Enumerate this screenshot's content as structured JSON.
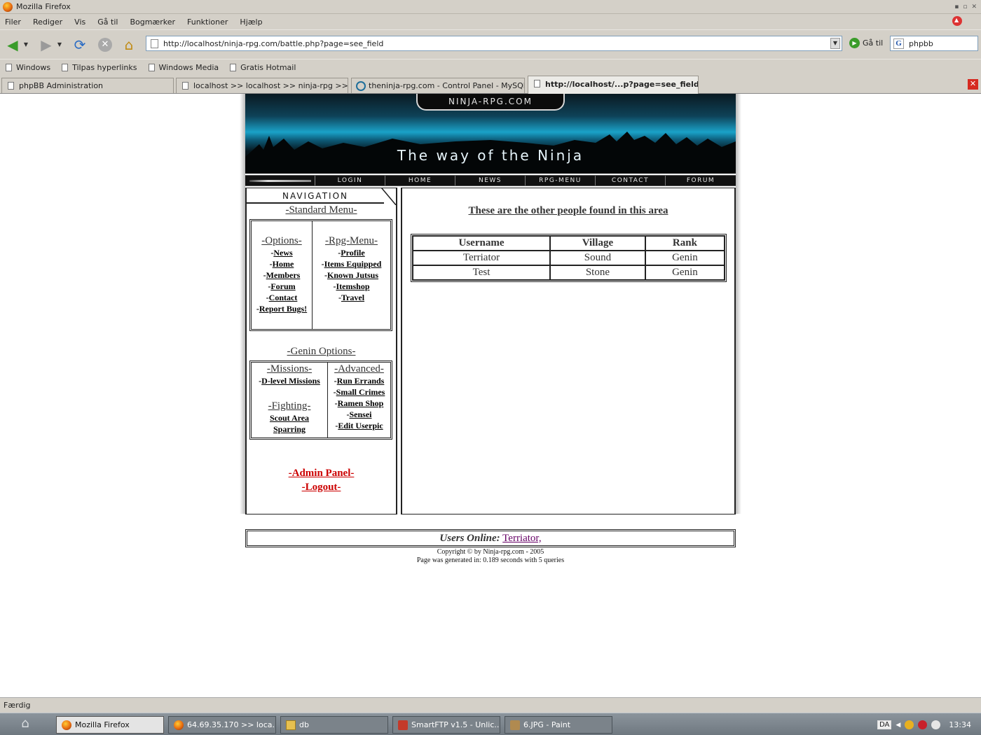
{
  "window": {
    "title": "Mozilla Firefox"
  },
  "menubar": [
    "Filer",
    "Rediger",
    "Vis",
    "Gå til",
    "Bogmærker",
    "Funktioner",
    "Hjælp"
  ],
  "toolbar": {
    "url": "http://localhost/ninja-rpg.com/battle.php?page=see_field",
    "go_label": "Gå til",
    "search_value": "phpbb",
    "icons": [
      "back-icon",
      "forward-icon",
      "reload-icon",
      "stop-icon",
      "home-icon"
    ]
  },
  "bookmarks": [
    "Windows",
    "Tilpas hyperlinks",
    "Windows Media",
    "Gratis Hotmail"
  ],
  "tabs": [
    {
      "label": "phpBB Administration"
    },
    {
      "label": "localhost >> localhost >> ninja-rpg  >> ..."
    },
    {
      "label": "theninja-rpg.com - Control Panel - MySQL ..."
    },
    {
      "label": "http://localhost/...p?page=see_field"
    }
  ],
  "site": {
    "logo_text": "NINJA-RPG.COM",
    "tagline": "The way of the Ninja",
    "topnav": [
      "Login",
      "Home",
      "News",
      "RPG-Menu",
      "Contact",
      "Forum"
    ],
    "nav_header": "NAVIGATION",
    "standard_menu_title": "-Standard Menu-",
    "options": {
      "title": "-Options-",
      "links": [
        {
          "prefix": "-",
          "label": "News"
        },
        {
          "prefix": "-",
          "label": "Home"
        },
        {
          "prefix": "-",
          "label": "Members"
        },
        {
          "prefix": "-",
          "label": "Forum"
        },
        {
          "prefix": "-",
          "label": "Contact"
        },
        {
          "prefix": "-",
          "label": "Report Bugs!"
        }
      ]
    },
    "rpg_menu": {
      "title": "-Rpg-Menu-",
      "links": [
        {
          "prefix": "-",
          "label": "Profile"
        },
        {
          "prefix": "-",
          "label": "Items Equipped"
        },
        {
          "prefix": "-",
          "label": "Known Jutsus"
        },
        {
          "prefix": "-",
          "label": "Itemshop"
        },
        {
          "prefix": "-",
          "label": "Travel"
        }
      ]
    },
    "genin_title": "-Genin Options-",
    "missions": {
      "title": "-Missions-",
      "links": [
        {
          "prefix": "-",
          "label": "D-level Missions"
        }
      ]
    },
    "fighting": {
      "title": "-Fighting-",
      "links": [
        {
          "prefix": "",
          "label": "Scout Area"
        },
        {
          "prefix": "",
          "label": "Sparring"
        }
      ]
    },
    "advanced": {
      "title": "-Advanced-",
      "links": [
        {
          "prefix": "-",
          "label": "Run Errands"
        },
        {
          "prefix": "-",
          "label": "Small Crimes"
        },
        {
          "prefix": "-",
          "label": "Ramen Shop"
        },
        {
          "prefix": "-",
          "label": "Sensei"
        },
        {
          "prefix": "-",
          "label": "Edit Userpic"
        }
      ]
    },
    "admin_panel": "-Admin Panel-",
    "logout": "-Logout-",
    "main_heading": "These are the other people found in this area",
    "table": {
      "headers": [
        "Username",
        "Village",
        "Rank"
      ],
      "rows": [
        [
          "Terriator",
          "Sound",
          "Genin"
        ],
        [
          "Test",
          "Stone",
          "Genin"
        ]
      ]
    },
    "users_online_label": "Users Online:",
    "users_online_value": "Terriator,",
    "copyright": "Copyright © by Ninja-rpg.com - 2005",
    "generated": "Page was generated in: 0.189 seconds with 5 queries"
  },
  "statusbar": {
    "text": "Færdig"
  },
  "taskbar": {
    "tasks": [
      {
        "label": "Mozilla Firefox",
        "icon": "firefox-icon"
      },
      {
        "label": "64.69.35.170 >> loca...",
        "icon": "firefox-icon"
      },
      {
        "label": "db",
        "icon": "folder-icon"
      },
      {
        "label": "SmartFTP v1.5 - Unlic...",
        "icon": "smartftp-icon"
      },
      {
        "label": "6.JPG - Paint",
        "icon": "paint-icon"
      }
    ],
    "lang": "DA",
    "clock": "13:34"
  }
}
